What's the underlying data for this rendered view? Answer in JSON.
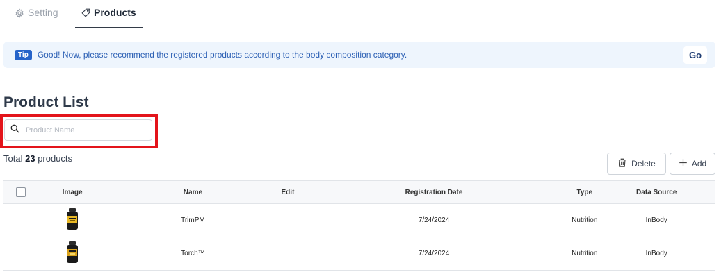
{
  "tabs": [
    {
      "label": "Setting",
      "icon": "gear-icon",
      "active": false
    },
    {
      "label": "Products",
      "icon": "tag-icon",
      "active": true
    }
  ],
  "tip": {
    "badge": "Tip",
    "text": "Good! Now, please recommend the registered products according to the body composition category.",
    "button": "Go"
  },
  "list": {
    "title": "Product List",
    "search_placeholder": "Product Name",
    "total_prefix": "Total",
    "total_count": "23",
    "total_suffix": "products",
    "delete_label": "Delete",
    "add_label": "Add"
  },
  "table": {
    "headers": [
      "Image",
      "Name",
      "Edit",
      "Registration Date",
      "Type",
      "Data Source"
    ],
    "rows": [
      {
        "name": "TrimPM",
        "edit": "",
        "date": "7/24/2024",
        "type": "Nutrition",
        "source": "InBody"
      },
      {
        "name": "Torch™",
        "edit": "",
        "date": "7/24/2024",
        "type": "Nutrition",
        "source": "InBody"
      }
    ]
  },
  "colors": {
    "accent": "#2563c9",
    "highlight": "#e3141b",
    "tip_bg": "#eef5fd"
  }
}
